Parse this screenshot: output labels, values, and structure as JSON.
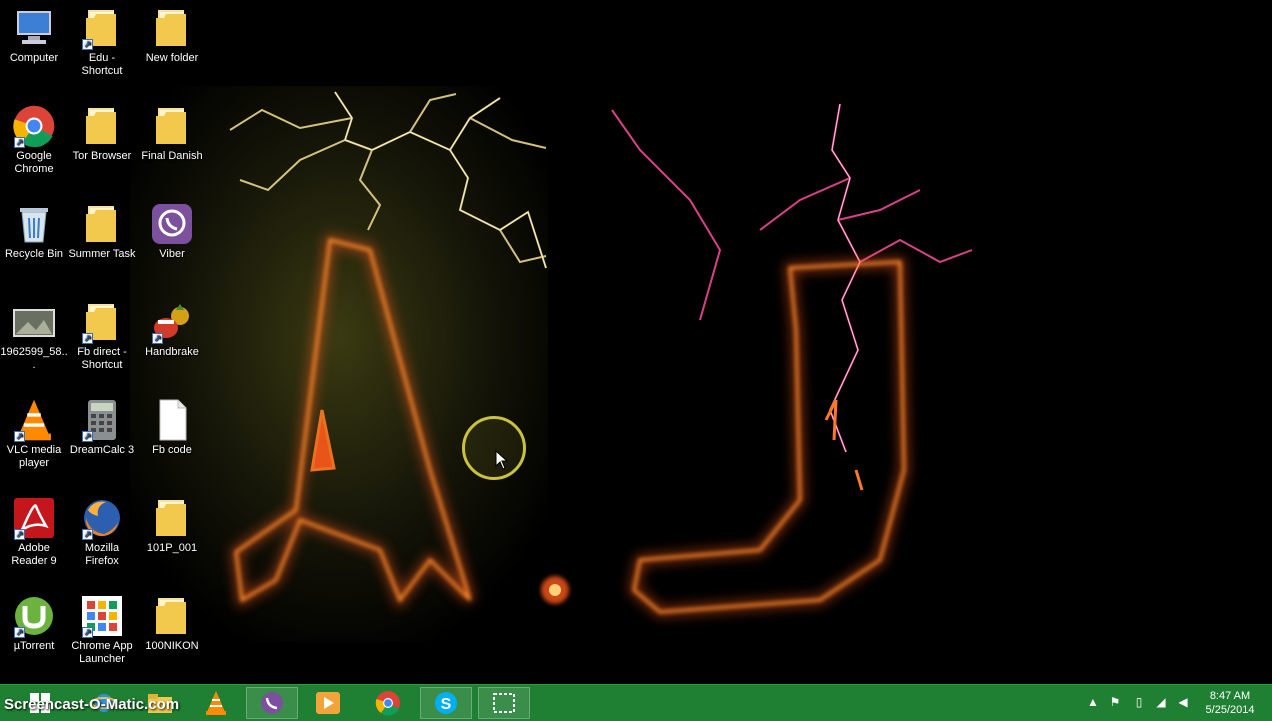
{
  "desktop": {
    "icons": [
      {
        "label": "Computer",
        "kind": "computer-icon",
        "shortcut": false
      },
      {
        "label": "Edu - Shortcut",
        "kind": "folder-icon",
        "shortcut": true
      },
      {
        "label": "New folder",
        "kind": "folder-icon",
        "shortcut": false
      },
      {
        "label": "Google Chrome",
        "kind": "chrome-icon",
        "shortcut": true
      },
      {
        "label": "Tor Browser",
        "kind": "folder-icon",
        "shortcut": false
      },
      {
        "label": "Final Danish",
        "kind": "folder-icon",
        "shortcut": false
      },
      {
        "label": "Recycle Bin",
        "kind": "recycle-bin-icon",
        "shortcut": false
      },
      {
        "label": "Summer Task",
        "kind": "folder-icon",
        "shortcut": false
      },
      {
        "label": "Viber",
        "kind": "viber-icon",
        "shortcut": false
      },
      {
        "label": "1962599_58...",
        "kind": "image-file-icon",
        "shortcut": false
      },
      {
        "label": "Fb direct - Shortcut",
        "kind": "folder-icon",
        "shortcut": true
      },
      {
        "label": "Handbrake",
        "kind": "handbrake-icon",
        "shortcut": true
      },
      {
        "label": "VLC media player",
        "kind": "vlc-icon",
        "shortcut": true
      },
      {
        "label": "DreamCalc 3",
        "kind": "calculator-icon",
        "shortcut": true
      },
      {
        "label": "Fb code",
        "kind": "text-file-icon",
        "shortcut": false
      },
      {
        "label": "Adobe Reader 9",
        "kind": "adobe-reader-icon",
        "shortcut": true
      },
      {
        "label": "Mozilla Firefox",
        "kind": "firefox-icon",
        "shortcut": true
      },
      {
        "label": "101P_001",
        "kind": "folder-icon",
        "shortcut": false
      },
      {
        "label": "µTorrent",
        "kind": "utorrent-icon",
        "shortcut": true
      },
      {
        "label": "Chrome App Launcher",
        "kind": "app-launcher-icon",
        "shortcut": true
      },
      {
        "label": "100NIKON",
        "kind": "folder-icon",
        "shortcut": false
      }
    ]
  },
  "wallpaper": {
    "left_letter": "A",
    "right_letter": "J"
  },
  "taskbar": {
    "watermark": "Screencast-O-Matic.com",
    "pinned": [
      {
        "name": "vlc-icon"
      },
      {
        "name": "viber-icon"
      },
      {
        "name": "media-player-icon"
      },
      {
        "name": "chrome-icon"
      },
      {
        "name": "skype-icon"
      },
      {
        "name": "screen-capture-icon"
      }
    ],
    "tray": {
      "time": "8:47 AM",
      "date": "5/25/2014"
    }
  },
  "colors": {
    "taskbar": "#1f7f32",
    "fire": "#ff5a1a",
    "lightning_left": "#e9d58a",
    "lightning_right": "#ff4da0"
  }
}
